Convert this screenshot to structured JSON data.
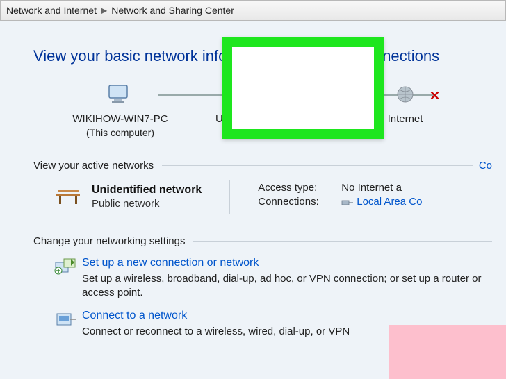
{
  "breadcrumb": {
    "parent": "Network and Internet",
    "current": "Network and Sharing Center"
  },
  "page_title": "View your basic network information and set up connections",
  "map": {
    "node1": {
      "name": "WIKIHOW-WIN7-PC",
      "sub": "(This computer)"
    },
    "node2": {
      "name": "Unidentified network"
    },
    "node3": {
      "name": "Internet"
    }
  },
  "sections": {
    "active_head": "View your active networks",
    "active_link": "Co",
    "change_head": "Change your networking settings"
  },
  "active_network": {
    "name": "Unidentified network",
    "type": "Public network",
    "access_label": "Access type:",
    "access_value": "No Internet a",
    "conn_label": "Connections:",
    "conn_value": "Local Area Co"
  },
  "settings": {
    "setup": {
      "title": "Set up a new connection or network",
      "desc": "Set up a wireless, broadband, dial-up, ad hoc, or VPN connection; or set up a router or access point."
    },
    "connect": {
      "title": "Connect to a network",
      "desc": "Connect or reconnect to a wireless, wired, dial-up, or VPN"
    }
  }
}
